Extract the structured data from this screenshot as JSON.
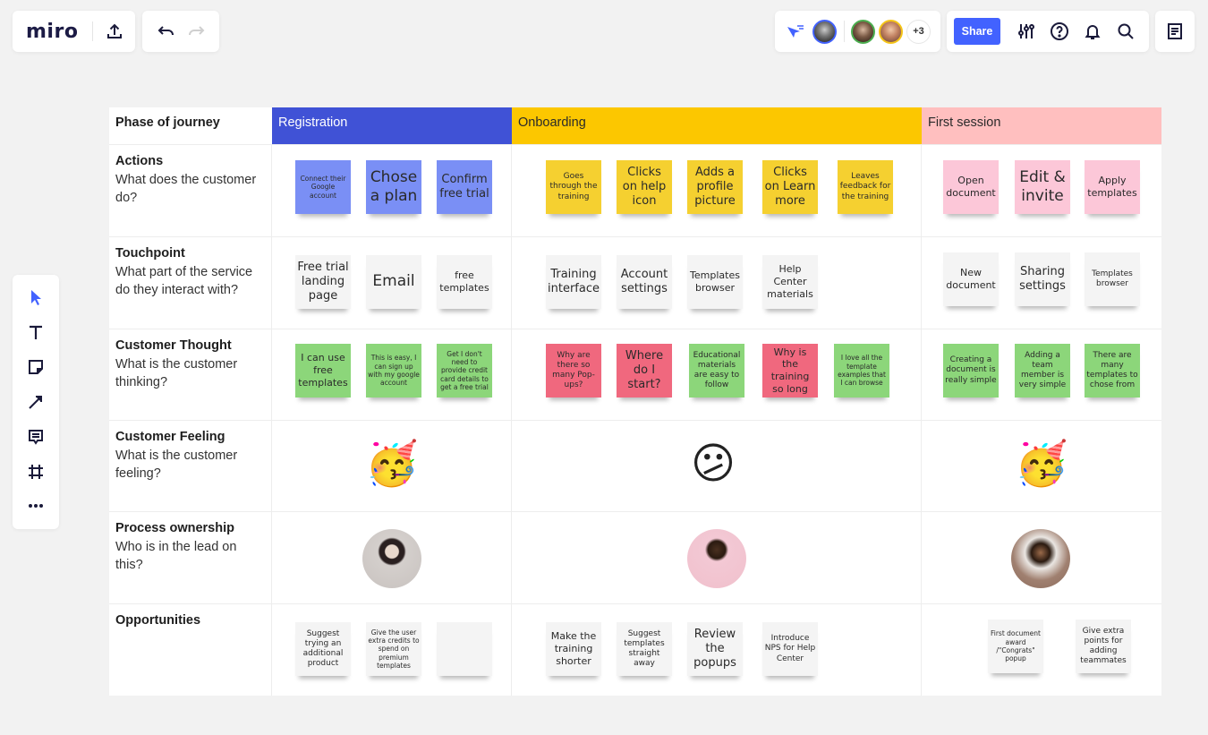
{
  "app": {
    "logo": "miro",
    "share_label": "Share",
    "collaborators_more": "+3",
    "icons": {
      "export": "upload-icon",
      "undo": "undo-icon",
      "redo": "redo-icon",
      "cursor_follow": "cursor-follow-icon",
      "settings": "sliders-icon",
      "help": "help-circle-icon",
      "notifications": "bell-icon",
      "search": "search-icon",
      "notes": "notes-icon"
    },
    "accent": "#4262ff"
  },
  "toolbar": {
    "tools": [
      {
        "name": "select",
        "icon": "cursor-icon",
        "active": true
      },
      {
        "name": "text",
        "icon": "text-icon"
      },
      {
        "name": "sticky note",
        "icon": "sticky-note-icon"
      },
      {
        "name": "connection line",
        "icon": "arrow-icon"
      },
      {
        "name": "comment",
        "icon": "comment-icon"
      },
      {
        "name": "frame",
        "icon": "frame-icon"
      },
      {
        "name": "more",
        "icon": "more-icon"
      }
    ]
  },
  "board": {
    "header_label": "Phase of journey",
    "phases": [
      {
        "label": "Registration",
        "color": "#4052d6",
        "text_color": "#ffffff"
      },
      {
        "label": "Onboarding",
        "color": "#fcc700",
        "text_color": "#2a2a2a"
      },
      {
        "label": "First session",
        "color": "#ffbfbf",
        "text_color": "#2a2a2a"
      }
    ],
    "rows": [
      {
        "title": "Actions",
        "subtitle": "What does the customer do?"
      },
      {
        "title": "Touchpoint",
        "subtitle": "What part of the service do they interact with?"
      },
      {
        "title": "Customer Thought",
        "subtitle": "What is the customer thinking?"
      },
      {
        "title": "Customer Feeling",
        "subtitle": "What is the customer feeling?"
      },
      {
        "title": "Process ownership",
        "subtitle": "Who is in the lead on this?"
      },
      {
        "title": "Opportunities",
        "subtitle": ""
      }
    ],
    "actions": {
      "registration": [
        "Connect their Google account",
        "Chose a plan",
        "Confirm free trial"
      ],
      "onboarding": [
        "Goes through the training",
        "Clicks on help icon",
        "Adds a profile picture",
        "Clicks on Learn more",
        "Leaves feedback for the training"
      ],
      "first_session": [
        "Open document",
        "Edit & invite",
        "Apply templates"
      ]
    },
    "touchpoints": {
      "registration": [
        "Free trial landing page",
        "Email",
        "free templates"
      ],
      "onboarding": [
        "Training interface",
        "Account settings",
        "Templates browser",
        "Help Center materials"
      ],
      "first_session": [
        "New document",
        "Sharing settings",
        "Templates browser"
      ]
    },
    "thoughts": {
      "registration": [
        "I can use free templates",
        "This is easy, I can sign up with my google account",
        "Get I don't need to provide credit card details to get a free trial"
      ],
      "onboarding": [
        "Why are there so many Pop-ups?",
        "Where do I start?",
        "Educational materials are easy to follow",
        "Why is the training so long",
        "I love all the template examples that I can browse"
      ],
      "first_session": [
        "Creating a document is really simple",
        "Adding a team member is very simple",
        "There are many templates to chose from"
      ]
    },
    "feelings": {
      "registration": "🥳",
      "onboarding": "😕",
      "first_session": "🥳"
    },
    "owners": {
      "registration": "avatar-photo-woman-long-hair",
      "onboarding": "avatar-photo-woman-curly-hair",
      "first_session": "avatar-photo-man-curly-hair"
    },
    "opportunities": {
      "registration": [
        "Suggest trying an additional product",
        "Give the user extra credits to spend on premium templates",
        ""
      ],
      "onboarding": [
        "Make the training shorter",
        "Suggest templates straight away",
        "Review the popups",
        "Introduce NPS for Help Center"
      ],
      "first_session": [
        "First document award /\"Congrats\" popup",
        "Give extra points for adding teammates"
      ]
    }
  }
}
